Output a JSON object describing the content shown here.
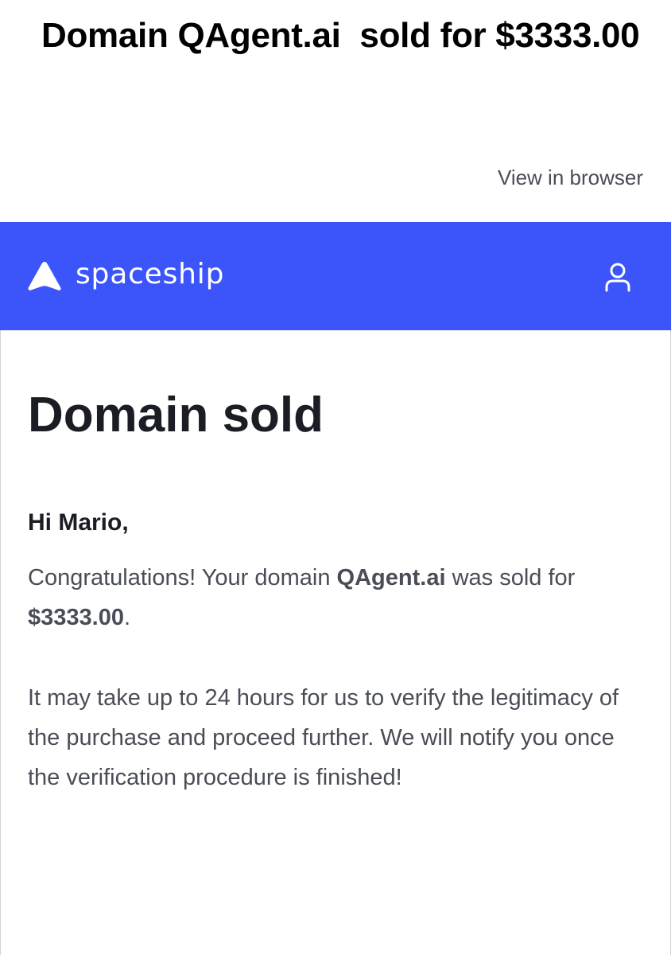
{
  "email": {
    "subject": "Domain QAgent.ai  sold for $3333.00",
    "view_in_browser": "View in browser"
  },
  "header": {
    "brand_name": "spaceship",
    "brand_icon": "spaceship-logo-icon",
    "account_icon": "user-icon",
    "background_color": "#3c55fa"
  },
  "body": {
    "heading": "Domain sold",
    "greeting": "Hi Mario,",
    "congrats_prefix": "Congratulations! Your domain ",
    "domain": "QAgent.ai",
    "congrats_middle": " was sold for ",
    "price": "$3333.00",
    "congrats_suffix": ".",
    "verification_text": "It may take up to 24 hours for us to verify the legitimacy of the purchase and proceed further. We will notify you once the verification procedure is finished!"
  }
}
